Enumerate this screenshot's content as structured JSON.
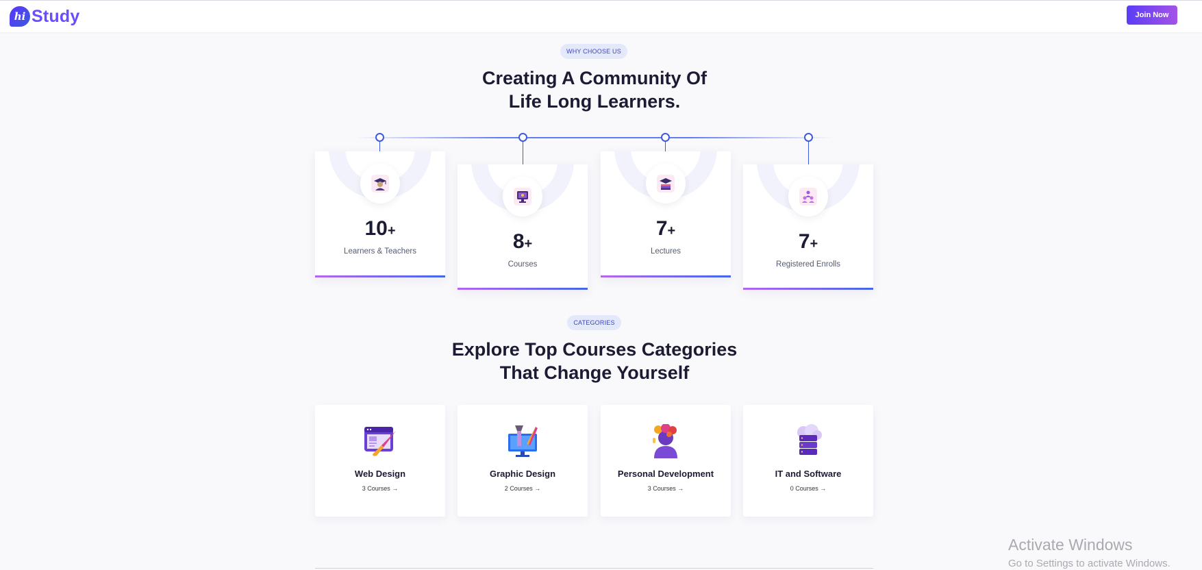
{
  "header": {
    "logo_mark": "hi",
    "logo_text": "Study",
    "join_label": "Join Now"
  },
  "why": {
    "pill": "WHY CHOOSE US",
    "heading_line1": "Creating A Community Of",
    "heading_line2": "Life Long Learners."
  },
  "stats": [
    {
      "value": "10",
      "suffix": "+",
      "label": "Learners & Teachers",
      "icon": "graduate-icon"
    },
    {
      "value": "8",
      "suffix": "+",
      "label": "Courses",
      "icon": "monitor-icon"
    },
    {
      "value": "7",
      "suffix": "+",
      "label": "Lectures",
      "icon": "book-cap-icon"
    },
    {
      "value": "7",
      "suffix": "+",
      "label": "Registered Enrolls",
      "icon": "group-icon"
    }
  ],
  "categories": {
    "pill": "CATEGORIES",
    "heading_line1": "Explore Top Courses Categories",
    "heading_line2": "That Change Yourself",
    "items": [
      {
        "title": "Web Design",
        "count": "3 Courses",
        "icon": "web-design-icon"
      },
      {
        "title": "Graphic Design",
        "count": "2 Courses",
        "icon": "graphic-design-icon"
      },
      {
        "title": "Personal Development",
        "count": "3 Courses",
        "icon": "personal-development-icon"
      },
      {
        "title": "IT and Software",
        "count": "0 Courses",
        "icon": "it-software-icon"
      }
    ]
  },
  "watermark": {
    "line1": "Activate Windows",
    "line2": "Go to Settings to activate Windows."
  },
  "colors": {
    "accent": "#3d59e0",
    "brand": "#6a4dff",
    "button_gradient_start": "#5a3df5",
    "button_gradient_end": "#a553e6"
  }
}
